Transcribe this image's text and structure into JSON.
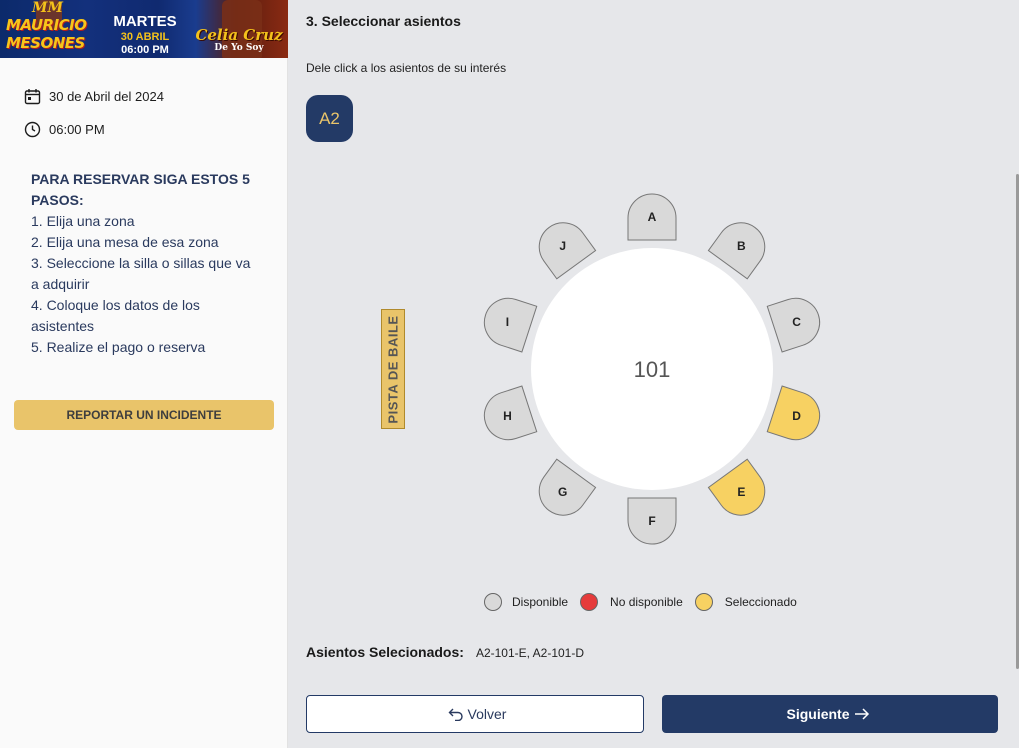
{
  "banner": {
    "logo_initials": "MM",
    "artist_line1": "MAURICIO",
    "artist_line2": "MESONES",
    "day": "MARTES",
    "date": "30 ABRIL",
    "time": "06:00 PM",
    "guest": "Celia Cruz",
    "guest_subtitle": "De Yo Soy"
  },
  "event": {
    "date": "30 de Abril del 2024",
    "time": "06:00 PM"
  },
  "instructions": {
    "title": "PARA RESERVAR SIGA ESTOS 5 PASOS:",
    "steps": [
      "1. Elija una zona",
      "2. Elija una mesa de esa zona",
      "3. Seleccione la silla o sillas que va a adquirir",
      "4. Coloque los datos de los asistentes",
      "5. Realize el pago o reserva"
    ]
  },
  "report_button": "REPORTAR UN INCIDENTE",
  "main": {
    "step_title": "3. Seleccionar asientos",
    "instruction": "Dele click a los asientos de su interés",
    "zone": "A2",
    "dance_floor": "PISTA DE BAILE",
    "table_number": "101"
  },
  "seats": [
    {
      "label": "A",
      "status": "available"
    },
    {
      "label": "B",
      "status": "available"
    },
    {
      "label": "C",
      "status": "available"
    },
    {
      "label": "D",
      "status": "selected"
    },
    {
      "label": "E",
      "status": "selected"
    },
    {
      "label": "F",
      "status": "available"
    },
    {
      "label": "G",
      "status": "available"
    },
    {
      "label": "H",
      "status": "available"
    },
    {
      "label": "I",
      "status": "available"
    },
    {
      "label": "J",
      "status": "available"
    }
  ],
  "legend": {
    "available": "Disponible",
    "unavailable": "No disponible",
    "selected": "Seleccionado"
  },
  "colors": {
    "available": "#d9d9d9",
    "unavailable": "#e63b3b",
    "selected": "#f7d162",
    "navy": "#233a66",
    "gold": "#e9c46a"
  },
  "selection": {
    "label": "Asientos Selecionados:",
    "value": "A2-101-E, A2-101-D"
  },
  "buttons": {
    "back": "Volver",
    "next": "Siguiente"
  }
}
